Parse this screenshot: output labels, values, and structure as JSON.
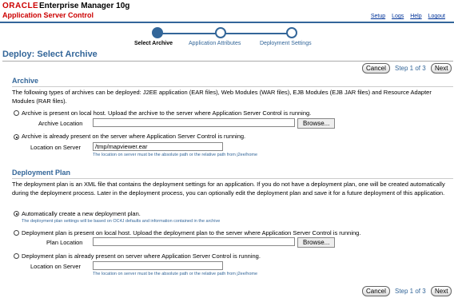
{
  "header": {
    "oracle": "ORACLE",
    "product": "Enterprise Manager 10g",
    "subtitle": "Application Server Control",
    "links": [
      "Setup",
      "Logs",
      "Help",
      "Logout"
    ]
  },
  "train": {
    "steps": [
      {
        "label": "Select Archive",
        "active": true
      },
      {
        "label": "Application Attributes",
        "active": false
      },
      {
        "label": "Deployment Settings",
        "active": false
      }
    ]
  },
  "page_title": "Deploy: Select Archive",
  "nav": {
    "cancel": "Cancel",
    "step_text": "Step 1 of 3",
    "next": "Next"
  },
  "archive": {
    "title": "Archive",
    "description": "The following types of archives can be deployed: J2EE application (EAR files), Web Modules (WAR files), EJB Modules (EJB JAR files) and Resource Adapter Modules (RAR files).",
    "option_local": "Archive is present on local host. Upload the archive to the server where Application Server Control is running.",
    "archive_location_label": "Archive Location",
    "archive_location_value": "",
    "browse": "Browse...",
    "option_server": "Archive is already present on the server where Application Server Control is running.",
    "location_on_server_label": "Location on Server",
    "location_on_server_value": "/tmp/mapviewer.ear",
    "location_hint": "The location on server must be the absolute path or the relative path from j2ee/home"
  },
  "plan": {
    "title": "Deployment Plan",
    "description": "The deployment plan is an XML file that contains the deployment settings for an application. If you do not have a deployment plan, one will be created automatically during the deployment process. Later in the deployment process, you can optionally edit the deployment plan and save it for a future deployment of this application.",
    "option_auto": "Automatically create a new deployment plan.",
    "auto_hint": "The deployment plan settings will be based on OC4J defaults and information contained in the archive",
    "option_local": "Deployment plan is present on local host. Upload the deployment plan to the server where Application Server Control is running.",
    "plan_location_label": "Plan Location",
    "plan_location_value": "",
    "browse": "Browse...",
    "option_server": "Deployment plan is already present on server where Application Server Control is running.",
    "location_on_server_label": "Location on Server",
    "location_on_server_value": "",
    "location_hint": "The location on server must be the absolute path or the relative path from j2ee/home"
  },
  "colors": {
    "accent": "#336699",
    "brand_red": "#cc0000",
    "link": "#003399"
  }
}
